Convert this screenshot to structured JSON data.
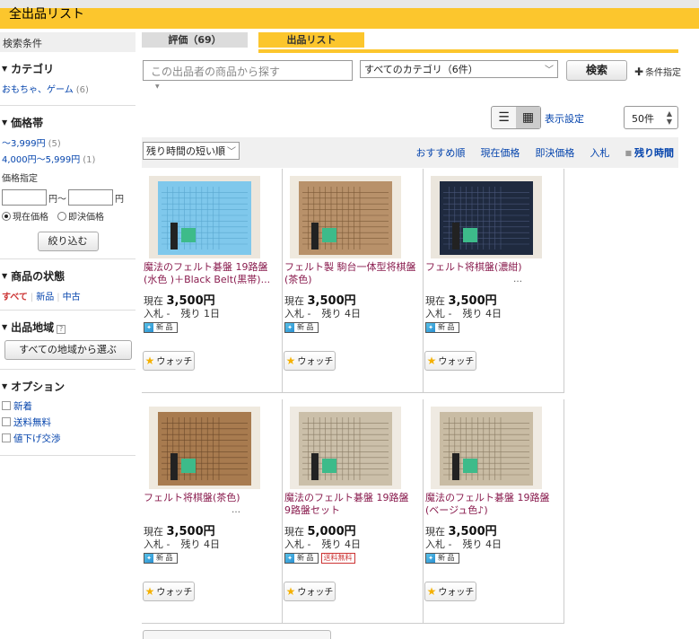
{
  "header": {
    "title": "全出品リスト"
  },
  "sidebar": {
    "head": "検索条件",
    "category": {
      "title": "カテゴリ",
      "items": [
        {
          "label": "おもちゃ、ゲーム",
          "count": "(6)"
        }
      ]
    },
    "price": {
      "title": "価格帯",
      "items": [
        {
          "label": "～3,999円",
          "count": "(5)"
        },
        {
          "label": "4,000円～5,999円",
          "count": "(1)"
        }
      ],
      "spec_label": "価格指定",
      "unit": "円",
      "tilde": "円～",
      "radio_current": "現在価格",
      "radio_buynow": "即決価格",
      "narrow_button": "絞り込む"
    },
    "condition": {
      "title": "商品の状態",
      "all": "すべて",
      "new": "新品",
      "used": "中古"
    },
    "region": {
      "title": "出品地域",
      "help": "?",
      "button": "すべての地域から選ぶ"
    },
    "options": {
      "title": "オプション",
      "items": [
        "新着",
        "送料無料",
        "値下げ交渉"
      ]
    }
  },
  "tabs": {
    "review": "評価（69）",
    "list": "出品リスト"
  },
  "search": {
    "placeholder": "この出品者の商品から探す",
    "category": "すべてのカテゴリ（6件）",
    "button": "検索",
    "cond_link": "条件指定"
  },
  "view": {
    "display_settings": "表示設定",
    "per_page": "50件"
  },
  "sort": {
    "selected": "残り時間の短い順",
    "links": [
      "おすすめ順",
      "現在価格",
      "即決価格",
      "入札",
      "残り時間"
    ],
    "current": "残り時間"
  },
  "items": [
    {
      "name": "魔法のフェルト碁盤 19路盤(水色 )＋Black Belt(黒帯)...",
      "price_label": "現在",
      "price": "3,500円",
      "bid_label": "入札",
      "bids": "-",
      "remain_label": "残り",
      "remain": "1日",
      "new_badge": "新 品",
      "ship_badge": "",
      "ellipsis": "",
      "watch": "ウォッチ",
      "board_color": "#7fc8ec",
      "line_color": "#5aa7d0",
      "bg_color": "#ece6dc"
    },
    {
      "name": "フェルト製 駒台一体型将棋盤 (茶色)",
      "price_label": "現在",
      "price": "3,500円",
      "bid_label": "入札",
      "bids": "-",
      "remain_label": "残り",
      "remain": "4日",
      "new_badge": "新 品",
      "ship_badge": "",
      "ellipsis": "",
      "watch": "ウォッチ",
      "board_color": "#b8916a",
      "line_color": "#7c5a38",
      "bg_color": "#efe9de"
    },
    {
      "name": "フェルト将棋盤(濃紺)",
      "price_label": "現在",
      "price": "3,500円",
      "bid_label": "入札",
      "bids": "-",
      "remain_label": "残り",
      "remain": "4日",
      "new_badge": "新 品",
      "ship_badge": "",
      "ellipsis": "…",
      "watch": "ウォッチ",
      "board_color": "#1f2a3f",
      "line_color": "#49567a",
      "bg_color": "#ebe6dd"
    },
    {
      "name": "フェルト将棋盤(茶色)",
      "price_label": "現在",
      "price": "3,500円",
      "bid_label": "入札",
      "bids": "-",
      "remain_label": "残り",
      "remain": "4日",
      "new_badge": "新 品",
      "ship_badge": "",
      "ellipsis": "…",
      "watch": "ウォッチ",
      "board_color": "#a87b4f",
      "line_color": "#6c4a2b",
      "bg_color": "#efe9de"
    },
    {
      "name": "魔法のフェルト碁盤 19路盤 9路盤セット",
      "price_label": "現在",
      "price": "5,000円",
      "bid_label": "入札",
      "bids": "-",
      "remain_label": "残り",
      "remain": "4日",
      "new_badge": "新 品",
      "ship_badge": "送料無料",
      "ellipsis": "",
      "watch": "ウォッチ",
      "board_color": "#cbbfa9",
      "line_color": "#8a7c66",
      "bg_color": "#efeae2"
    },
    {
      "name": "魔法のフェルト碁盤 19路盤 (ベージュ色♪)",
      "price_label": "現在",
      "price": "3,500円",
      "bid_label": "入札",
      "bids": "-",
      "remain_label": "残り",
      "remain": "4日",
      "new_badge": "新 品",
      "ship_badge": "",
      "ellipsis": "",
      "watch": "ウォッチ",
      "board_color": "#c9bca4",
      "line_color": "#8b7d65",
      "bg_color": "#efeae2"
    }
  ]
}
